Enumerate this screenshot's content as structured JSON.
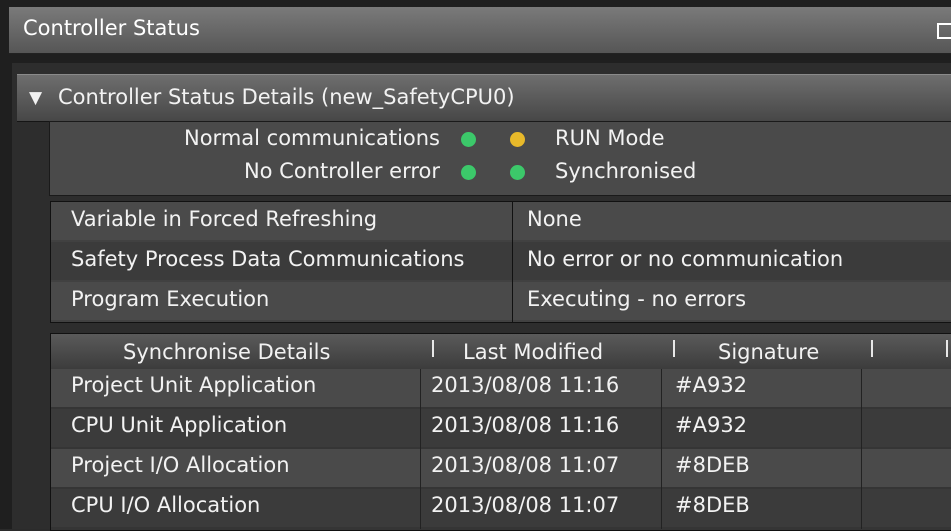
{
  "window": {
    "title": "Controller Status"
  },
  "section": {
    "toggle": "▼",
    "title": "Controller Status Details (new_SafetyCPU0)"
  },
  "status": [
    {
      "left": "Normal communications",
      "left_dot": "#3cc86a",
      "right_dot": "#e8b92a",
      "right": "RUN Mode"
    },
    {
      "left": "No Controller error",
      "left_dot": "#3cc86a",
      "right_dot": "#3cc86a",
      "right": "Synchronised"
    }
  ],
  "properties": [
    {
      "key": "Variable in Forced Refreshing",
      "value": "None"
    },
    {
      "key": "Safety Process Data Communications",
      "value": "No error or no communication"
    },
    {
      "key": "Program Execution",
      "value": "Executing - no errors"
    }
  ],
  "sync_table": {
    "headers": [
      "Synchronise Details",
      "Last Modified",
      "Signature"
    ],
    "rows": [
      [
        "Project Unit Application",
        "2013/08/08 11:16",
        "#A932"
      ],
      [
        "CPU Unit Application",
        "2013/08/08 11:16",
        "#A932"
      ],
      [
        "Project I/O Allocation",
        "2013/08/08 11:07",
        "#8DEB"
      ],
      [
        "CPU I/O Allocation",
        "2013/08/08 11:07",
        "#8DEB"
      ]
    ]
  }
}
